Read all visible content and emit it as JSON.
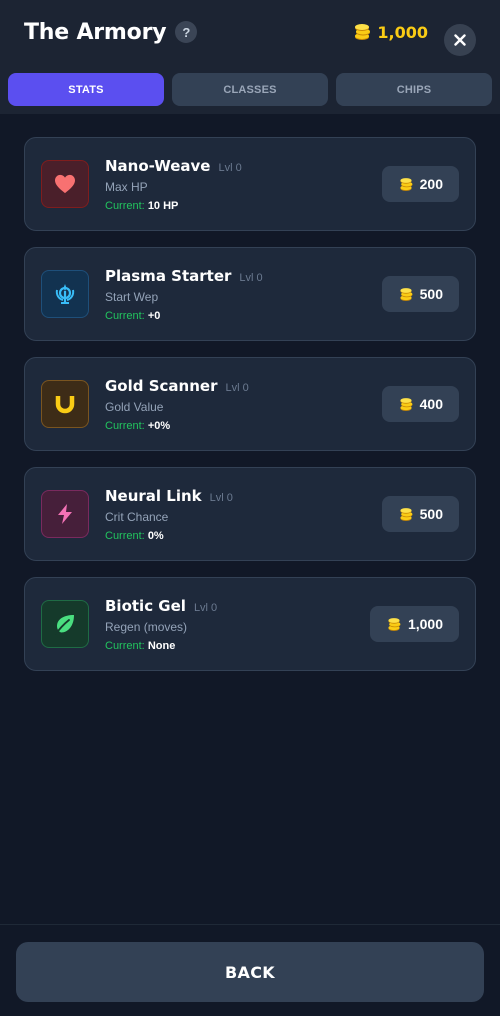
{
  "header": {
    "title": "The Armory",
    "help_label": "?",
    "balance": "1,000",
    "close_label": "✕"
  },
  "tabs": [
    {
      "label": "STATS",
      "active": true
    },
    {
      "label": "CLASSES",
      "active": false
    },
    {
      "label": "CHIPS",
      "active": false
    }
  ],
  "upgrades": [
    {
      "name": "Nano-Weave",
      "level": "Lvl 0",
      "description": "Max HP",
      "current_label": "Current:",
      "current_value": "10 HP",
      "price": "200",
      "icon": "heart-icon",
      "icon_bg": "#4a1f2a",
      "icon_border": "#7f1d1d",
      "icon_color": "#f87171"
    },
    {
      "name": "Plasma Starter",
      "level": "Lvl 0",
      "description": "Start Wep",
      "current_label": "Current:",
      "current_value": "+0",
      "price": "500",
      "icon": "weapon-emblem-icon",
      "icon_bg": "#123250",
      "icon_border": "#1e4f7a",
      "icon_color": "#38bdf8"
    },
    {
      "name": "Gold Scanner",
      "level": "Lvl 0",
      "description": "Gold Value",
      "current_label": "Current:",
      "current_value": "+0%",
      "price": "400",
      "icon": "magnet-icon",
      "icon_bg": "#3d2c17",
      "icon_border": "#7a5520",
      "icon_color": "#facc15"
    },
    {
      "name": "Neural Link",
      "level": "Lvl 0",
      "description": "Crit Chance",
      "current_label": "Current:",
      "current_value": "0%",
      "price": "500",
      "icon": "lightning-icon",
      "icon_bg": "#461f3a",
      "icon_border": "#7a2a5e",
      "icon_color": "#f472b6"
    },
    {
      "name": "Biotic Gel",
      "level": "Lvl 0",
      "description": "Regen (moves)",
      "current_label": "Current:",
      "current_value": "None",
      "price": "1,000",
      "icon": "leaf-icon",
      "icon_bg": "#153a2b",
      "icon_border": "#1f6b45",
      "icon_color": "#4ade80"
    }
  ],
  "footer": {
    "back_label": "BACK"
  },
  "colors": {
    "accent": "#5b4ff0",
    "gold": "#facc15",
    "current_green": "#22c55e"
  }
}
